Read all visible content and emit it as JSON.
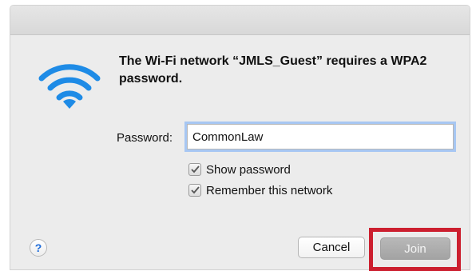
{
  "dialog": {
    "message": "The Wi-Fi network “JMLS_Guest” requires a WPA2 password.",
    "password_label": "Password:",
    "password_value": "CommonLaw",
    "checkboxes": [
      {
        "label": "Show password",
        "checked": true
      },
      {
        "label": "Remember this network",
        "checked": true
      }
    ],
    "help_label": "?",
    "cancel_label": "Cancel",
    "join_label": "Join"
  },
  "colors": {
    "wifi_icon": "#1e8be6",
    "highlight_box": "#cc1f2f"
  },
  "icons": {
    "wifi": "wifi-icon",
    "help": "help-icon",
    "checkmark": "checkmark-icon"
  }
}
